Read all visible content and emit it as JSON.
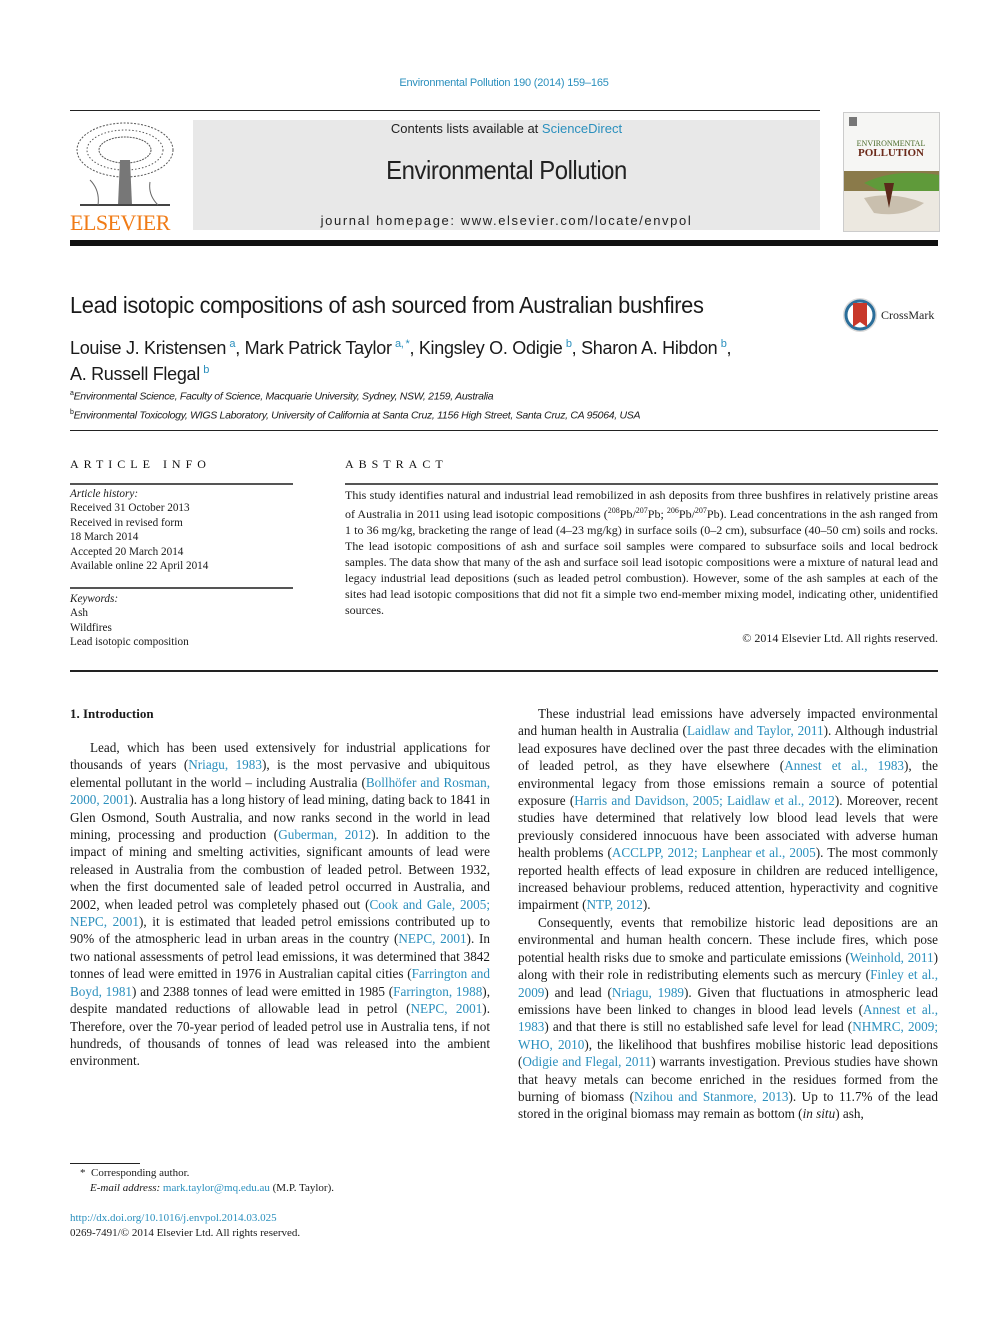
{
  "header": {
    "journal_ref": "Environmental Pollution 190 (2014) 159–165",
    "contents_prefix": "Contents lists available at ",
    "contents_link": "ScienceDirect",
    "journal_title": "Environmental Pollution",
    "homepage": "journal homepage: www.elsevier.com/locate/envpol",
    "publisher_logo_text": "ELSEVIER",
    "cover": {
      "line1": "ENVIRONMENTAL",
      "line2": "POLLUTION"
    },
    "colors": {
      "link": "#2a8fbd",
      "elsevier_orange": "#f07b16",
      "banner": "#e8e8e8"
    }
  },
  "article": {
    "title": "Lead isotopic compositions of ash sourced from Australian bushfires",
    "crossmark_label": "CrossMark",
    "authors": [
      {
        "name": "Louise J. Kristensen",
        "aff": "a"
      },
      {
        "name": "Mark Patrick Taylor",
        "aff": "a, *"
      },
      {
        "name": "Kingsley O. Odigie",
        "aff": "b"
      },
      {
        "name": "Sharon A. Hibdon",
        "aff": "b"
      },
      {
        "name": "A. Russell Flegal",
        "aff": "b"
      }
    ],
    "affiliations": [
      {
        "key": "a",
        "text": "Environmental Science, Faculty of Science, Macquarie University, Sydney, NSW, 2159, Australia"
      },
      {
        "key": "b",
        "text": "Environmental Toxicology, WIGS Laboratory, University of California at Santa Cruz, 1156 High Street, Santa Cruz, CA 95064, USA"
      }
    ]
  },
  "article_info": {
    "heading": "ARTICLE INFO",
    "history_label": "Article history:",
    "history": [
      "Received 31 October 2013",
      "Received in revised form",
      "18 March 2014",
      "Accepted 20 March 2014",
      "Available online 22 April 2014"
    ],
    "keywords_label": "Keywords:",
    "keywords": [
      "Ash",
      "Wildfires",
      "Lead isotopic composition"
    ]
  },
  "abstract": {
    "heading": "ABSTRACT",
    "part1": "This study identifies natural and industrial lead remobilized in ash deposits from three bushfires in relatively pristine areas of Australia in 2011 using lead isotopic compositions (",
    "iso1_a": "208",
    "iso1_b": "207",
    "iso2_a": "206",
    "iso2_b": "207",
    "part2": "Lead concentrations in the ash ranged from 1 to 36 mg/kg, bracketing the range of lead (4–23 mg/kg) in surface soils (0–2 cm), subsurface (40–50 cm) soils and rocks. The lead isotopic compositions of ash and surface soil samples were compared to subsurface soils and local bedrock samples. The data show that many of the ash and surface soil lead isotopic compositions were a mixture of natural lead and legacy industrial lead depositions (such as leaded petrol combustion). However, some of the ash samples at each of the sites had lead isotopic compositions that did not fit a simple two end-member mixing model, indicating other, unidentified sources.",
    "copyright": "© 2014 Elsevier Ltd. All rights reserved."
  },
  "body": {
    "section_heading": "1.  Introduction",
    "left": {
      "t1": "Lead, which has been used extensively for industrial applications for thousands of years (",
      "c1": "Nriagu, 1983",
      "t2": "), is the most pervasive and ubiquitous elemental pollutant in the world – including Australia (",
      "c2": "Bollhöfer and Rosman, 2000, 2001",
      "t3": "). Australia has a long history of lead mining, dating back to 1841 in Glen Osmond, South Australia, and now ranks second in the world in lead mining, processing and production (",
      "c3": "Guberman, 2012",
      "t4": "). In addition to the impact of mining and smelting activities, significant amounts of lead were released in Australia from the combustion of leaded petrol. Between 1932, when the first documented sale of leaded petrol occurred in Australia, and 2002, when leaded petrol was completely phased out (",
      "c4": "Cook and Gale, 2005; NEPC, 2001",
      "t5": "), it is estimated that leaded petrol emissions contributed up to 90% of the atmospheric lead in urban areas in the country (",
      "c5": "NEPC, 2001",
      "t6": "). In two national assessments of petrol lead emissions, it was determined that 3842 tonnes of lead were emitted in 1976 in Australian capital cities (",
      "c6": "Farrington and Boyd, 1981",
      "t7": ") and 2388 tonnes of lead were emitted in 1985 (",
      "c7": "Farrington, 1988",
      "t8": "), despite mandated reductions of allowable lead in petrol (",
      "c8": "NEPC, 2001",
      "t9": "). Therefore, over the 70-year period of leaded petrol use in Australia tens, if not hundreds, of thousands of tonnes of lead was released into the ambient environment."
    },
    "right_p1": {
      "t1": "These industrial lead emissions have adversely impacted environmental and human health in Australia (",
      "c1": "Laidlaw and Taylor, 2011",
      "t2": "). Although industrial lead exposures have declined over the past three decades with the elimination of leaded petrol, as they have elsewhere (",
      "c2": "Annest et al., 1983",
      "t3": "), the environmental legacy from those emissions remain a source of potential exposure (",
      "c3": "Harris and Davidson, 2005; Laidlaw et al., 2012",
      "t4": "). Moreover, recent studies have determined that relatively low blood lead levels that were previously considered innocuous have been associated with adverse human health problems (",
      "c4": "ACCLPP, 2012; Lanphear et al., 2005",
      "t5": "). The most commonly reported health effects of lead exposure in children are reduced intelligence, increased behaviour problems, reduced attention, hyperactivity and cognitive impairment (",
      "c5": "NTP, 2012",
      "t6": ")."
    },
    "right_p2": {
      "t1": "Consequently, events that remobilize historic lead depositions are an environmental and human health concern. These include fires, which pose potential health risks due to smoke and particulate emissions (",
      "c1": "Weinhold, 2011",
      "t2": ") along with their role in redistributing elements such as mercury (",
      "c2": "Finley et al., 2009",
      "t3": ") and lead (",
      "c3": "Nriagu, 1989",
      "t4": "). Given that fluctuations in atmospheric lead emissions have been linked to changes in blood lead levels (",
      "c4": "Annest et al., 1983",
      "t5": ") and that there is still no established safe level for lead (",
      "c5": "NHMRC, 2009; WHO, 2010",
      "t6": "), the likelihood that bushfires mobilise historic lead depositions (",
      "c6": "Odigie and Flegal, 2011",
      "t7": ") warrants investigation. Previous studies have shown that heavy metals can become enriched in the residues formed from the burning of biomass (",
      "c7": "Nzihou and Stanmore, 2013",
      "t8": "). Up to 11.7% of the lead stored in the original biomass may remain as bottom (",
      "t8i": "in situ",
      "t9": ") ash,"
    }
  },
  "footer": {
    "star": "*",
    "corresponding": "Corresponding author.",
    "email_label": "E-mail address:",
    "email": "mark.taylor@mq.edu.au",
    "email_suffix": " (M.P. Taylor).",
    "doi": "http://dx.doi.org/10.1016/j.envpol.2014.03.025",
    "issn": "0269-7491/© 2014 Elsevier Ltd. All rights reserved."
  }
}
